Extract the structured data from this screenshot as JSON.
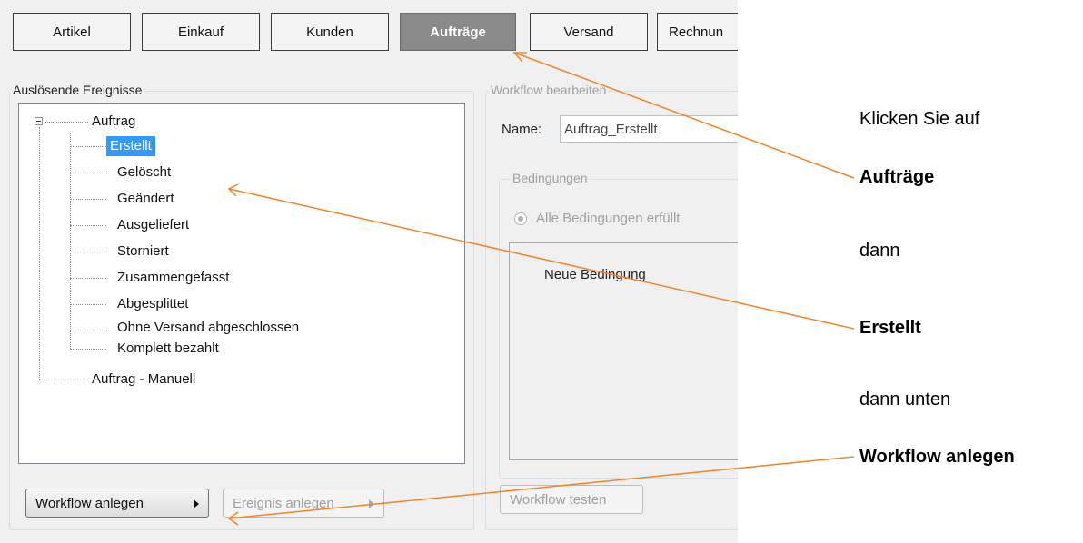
{
  "tabs": [
    {
      "label": "Artikel",
      "active": false
    },
    {
      "label": "Einkauf",
      "active": false
    },
    {
      "label": "Kunden",
      "active": false
    },
    {
      "label": "Aufträge",
      "active": true
    },
    {
      "label": "Versand",
      "active": false
    },
    {
      "label": "Rechnun",
      "active": false
    }
  ],
  "left_panel": {
    "legend": "Auslösende Ereignisse",
    "tree": {
      "root": "Auftrag",
      "children": [
        {
          "label": "Erstellt",
          "selected": true
        },
        {
          "label": "Gelöscht"
        },
        {
          "label": "Geändert"
        },
        {
          "label": "Ausgeliefert"
        },
        {
          "label": "Storniert"
        },
        {
          "label": "Zusammengefasst"
        },
        {
          "label": "Abgesplittet"
        },
        {
          "label": "Ohne Versand abgeschlossen"
        },
        {
          "label": "Komplett bezahlt"
        }
      ],
      "second_root": "Auftrag - Manuell"
    },
    "workflow_anlegen_label": "Workflow anlegen",
    "ereignis_anlegen_label": "Ereignis anlegen"
  },
  "right_panel": {
    "legend": "Workflow bearbeiten",
    "name_label": "Name:",
    "name_value": "Auftrag_Erstellt",
    "bedingungen_legend": "Bedingungen",
    "radio_label": "Alle Bedingungen erfüllt",
    "neue_bedingung": "Neue Bedingung",
    "workflow_testen_label": "Workflow testen"
  },
  "instructions": {
    "line1": "Klicken Sie auf",
    "line2": "Aufträge",
    "line3": "dann",
    "line4": "Erstellt",
    "line5": "dann unten",
    "line6": "Workflow anlegen"
  },
  "colors": {
    "arrow": "#f0862a",
    "selection": "#3399ff",
    "active_tab": "#8a8a8a"
  }
}
